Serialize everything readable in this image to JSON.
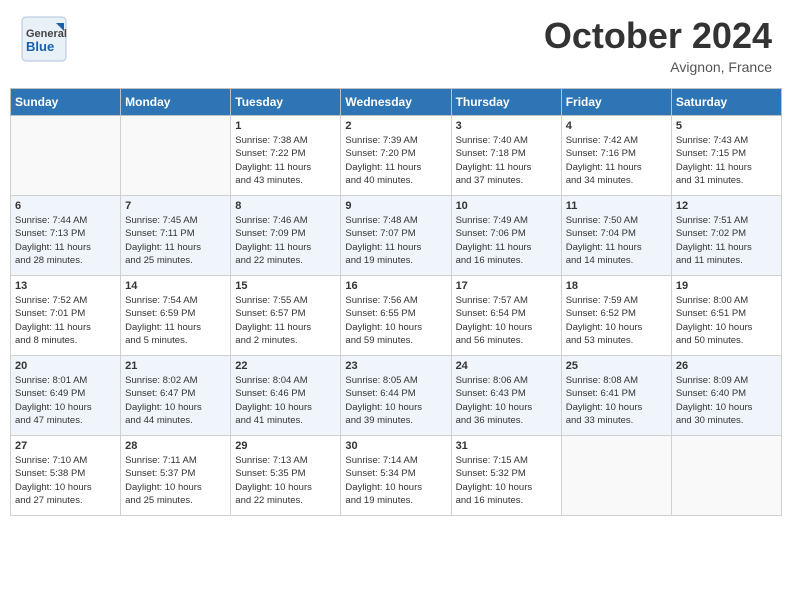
{
  "header": {
    "logo_general": "General",
    "logo_blue": "Blue",
    "month_title": "October 2024",
    "location": "Avignon, France"
  },
  "days_of_week": [
    "Sunday",
    "Monday",
    "Tuesday",
    "Wednesday",
    "Thursday",
    "Friday",
    "Saturday"
  ],
  "weeks": [
    [
      {
        "day": "",
        "sunrise": "",
        "sunset": "",
        "daylight": ""
      },
      {
        "day": "",
        "sunrise": "",
        "sunset": "",
        "daylight": ""
      },
      {
        "day": "1",
        "sunrise": "Sunrise: 7:38 AM",
        "sunset": "Sunset: 7:22 PM",
        "daylight": "Daylight: 11 hours and 43 minutes."
      },
      {
        "day": "2",
        "sunrise": "Sunrise: 7:39 AM",
        "sunset": "Sunset: 7:20 PM",
        "daylight": "Daylight: 11 hours and 40 minutes."
      },
      {
        "day": "3",
        "sunrise": "Sunrise: 7:40 AM",
        "sunset": "Sunset: 7:18 PM",
        "daylight": "Daylight: 11 hours and 37 minutes."
      },
      {
        "day": "4",
        "sunrise": "Sunrise: 7:42 AM",
        "sunset": "Sunset: 7:16 PM",
        "daylight": "Daylight: 11 hours and 34 minutes."
      },
      {
        "day": "5",
        "sunrise": "Sunrise: 7:43 AM",
        "sunset": "Sunset: 7:15 PM",
        "daylight": "Daylight: 11 hours and 31 minutes."
      }
    ],
    [
      {
        "day": "6",
        "sunrise": "Sunrise: 7:44 AM",
        "sunset": "Sunset: 7:13 PM",
        "daylight": "Daylight: 11 hours and 28 minutes."
      },
      {
        "day": "7",
        "sunrise": "Sunrise: 7:45 AM",
        "sunset": "Sunset: 7:11 PM",
        "daylight": "Daylight: 11 hours and 25 minutes."
      },
      {
        "day": "8",
        "sunrise": "Sunrise: 7:46 AM",
        "sunset": "Sunset: 7:09 PM",
        "daylight": "Daylight: 11 hours and 22 minutes."
      },
      {
        "day": "9",
        "sunrise": "Sunrise: 7:48 AM",
        "sunset": "Sunset: 7:07 PM",
        "daylight": "Daylight: 11 hours and 19 minutes."
      },
      {
        "day": "10",
        "sunrise": "Sunrise: 7:49 AM",
        "sunset": "Sunset: 7:06 PM",
        "daylight": "Daylight: 11 hours and 16 minutes."
      },
      {
        "day": "11",
        "sunrise": "Sunrise: 7:50 AM",
        "sunset": "Sunset: 7:04 PM",
        "daylight": "Daylight: 11 hours and 14 minutes."
      },
      {
        "day": "12",
        "sunrise": "Sunrise: 7:51 AM",
        "sunset": "Sunset: 7:02 PM",
        "daylight": "Daylight: 11 hours and 11 minutes."
      }
    ],
    [
      {
        "day": "13",
        "sunrise": "Sunrise: 7:52 AM",
        "sunset": "Sunset: 7:01 PM",
        "daylight": "Daylight: 11 hours and 8 minutes."
      },
      {
        "day": "14",
        "sunrise": "Sunrise: 7:54 AM",
        "sunset": "Sunset: 6:59 PM",
        "daylight": "Daylight: 11 hours and 5 minutes."
      },
      {
        "day": "15",
        "sunrise": "Sunrise: 7:55 AM",
        "sunset": "Sunset: 6:57 PM",
        "daylight": "Daylight: 11 hours and 2 minutes."
      },
      {
        "day": "16",
        "sunrise": "Sunrise: 7:56 AM",
        "sunset": "Sunset: 6:55 PM",
        "daylight": "Daylight: 10 hours and 59 minutes."
      },
      {
        "day": "17",
        "sunrise": "Sunrise: 7:57 AM",
        "sunset": "Sunset: 6:54 PM",
        "daylight": "Daylight: 10 hours and 56 minutes."
      },
      {
        "day": "18",
        "sunrise": "Sunrise: 7:59 AM",
        "sunset": "Sunset: 6:52 PM",
        "daylight": "Daylight: 10 hours and 53 minutes."
      },
      {
        "day": "19",
        "sunrise": "Sunrise: 8:00 AM",
        "sunset": "Sunset: 6:51 PM",
        "daylight": "Daylight: 10 hours and 50 minutes."
      }
    ],
    [
      {
        "day": "20",
        "sunrise": "Sunrise: 8:01 AM",
        "sunset": "Sunset: 6:49 PM",
        "daylight": "Daylight: 10 hours and 47 minutes."
      },
      {
        "day": "21",
        "sunrise": "Sunrise: 8:02 AM",
        "sunset": "Sunset: 6:47 PM",
        "daylight": "Daylight: 10 hours and 44 minutes."
      },
      {
        "day": "22",
        "sunrise": "Sunrise: 8:04 AM",
        "sunset": "Sunset: 6:46 PM",
        "daylight": "Daylight: 10 hours and 41 minutes."
      },
      {
        "day": "23",
        "sunrise": "Sunrise: 8:05 AM",
        "sunset": "Sunset: 6:44 PM",
        "daylight": "Daylight: 10 hours and 39 minutes."
      },
      {
        "day": "24",
        "sunrise": "Sunrise: 8:06 AM",
        "sunset": "Sunset: 6:43 PM",
        "daylight": "Daylight: 10 hours and 36 minutes."
      },
      {
        "day": "25",
        "sunrise": "Sunrise: 8:08 AM",
        "sunset": "Sunset: 6:41 PM",
        "daylight": "Daylight: 10 hours and 33 minutes."
      },
      {
        "day": "26",
        "sunrise": "Sunrise: 8:09 AM",
        "sunset": "Sunset: 6:40 PM",
        "daylight": "Daylight: 10 hours and 30 minutes."
      }
    ],
    [
      {
        "day": "27",
        "sunrise": "Sunrise: 7:10 AM",
        "sunset": "Sunset: 5:38 PM",
        "daylight": "Daylight: 10 hours and 27 minutes."
      },
      {
        "day": "28",
        "sunrise": "Sunrise: 7:11 AM",
        "sunset": "Sunset: 5:37 PM",
        "daylight": "Daylight: 10 hours and 25 minutes."
      },
      {
        "day": "29",
        "sunrise": "Sunrise: 7:13 AM",
        "sunset": "Sunset: 5:35 PM",
        "daylight": "Daylight: 10 hours and 22 minutes."
      },
      {
        "day": "30",
        "sunrise": "Sunrise: 7:14 AM",
        "sunset": "Sunset: 5:34 PM",
        "daylight": "Daylight: 10 hours and 19 minutes."
      },
      {
        "day": "31",
        "sunrise": "Sunrise: 7:15 AM",
        "sunset": "Sunset: 5:32 PM",
        "daylight": "Daylight: 10 hours and 16 minutes."
      },
      {
        "day": "",
        "sunrise": "",
        "sunset": "",
        "daylight": ""
      },
      {
        "day": "",
        "sunrise": "",
        "sunset": "",
        "daylight": ""
      }
    ]
  ]
}
